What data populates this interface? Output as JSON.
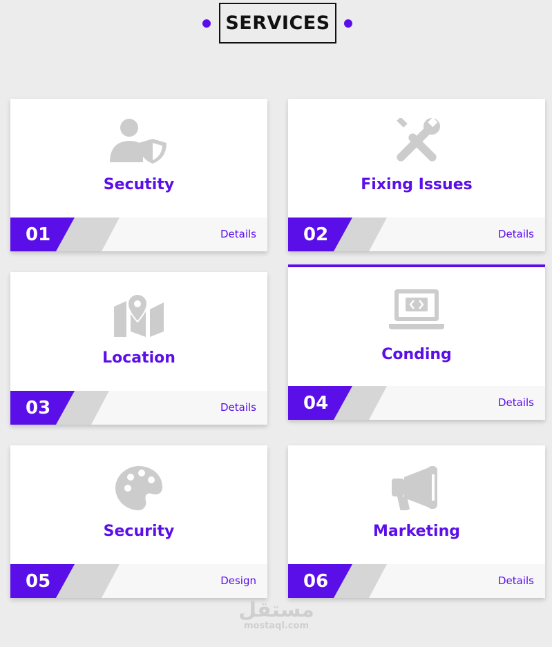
{
  "header": {
    "title": "SERVICES"
  },
  "cards": [
    {
      "number": "01",
      "title": "Secutity",
      "link": "Details",
      "icon": "user-shield-icon"
    },
    {
      "number": "02",
      "title": "Fixing Issues",
      "link": "Details",
      "icon": "tools-icon"
    },
    {
      "number": "03",
      "title": "Location",
      "link": "Details",
      "icon": "map-pin-icon"
    },
    {
      "number": "04",
      "title": "Conding",
      "link": "Details",
      "icon": "laptop-code-icon"
    },
    {
      "number": "05",
      "title": "Security",
      "link": "Design",
      "icon": "palette-icon"
    },
    {
      "number": "06",
      "title": "Marketing",
      "link": "Details",
      "icon": "megaphone-icon"
    }
  ],
  "watermark": {
    "arabic": "مستقل",
    "latin": "mostaql.com"
  },
  "colors": {
    "accent": "#5a0fe8",
    "icon": "#cccccc",
    "background": "#ececec"
  }
}
